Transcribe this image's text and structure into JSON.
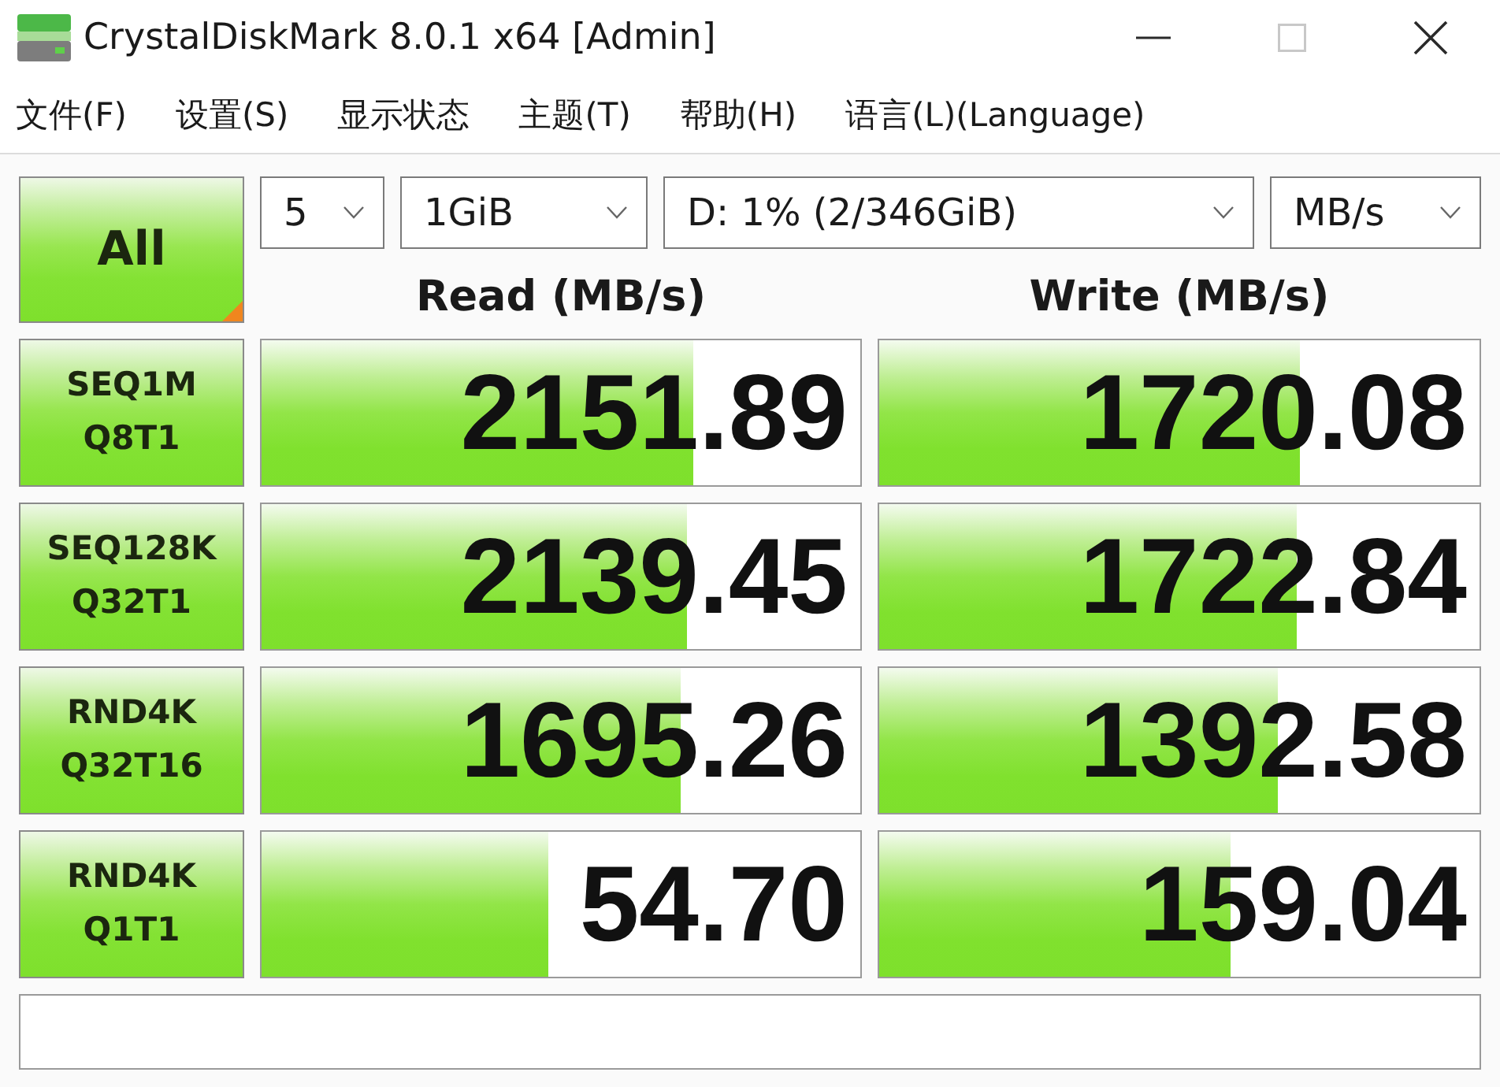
{
  "window": {
    "title": "CrystalDiskMark 8.0.1 x64 [Admin]",
    "controls": [
      {
        "kind": "minimize",
        "disabled": false
      },
      {
        "kind": "maximize",
        "disabled": true
      },
      {
        "kind": "close",
        "disabled": false
      }
    ]
  },
  "menu": [
    "文件(F)",
    "设置(S)",
    "显示状态",
    "主题(T)",
    "帮助(H)",
    "语言(L)(Language)"
  ],
  "all_button": {
    "label": "All"
  },
  "dropdowns": [
    {
      "kind": "count",
      "value": "5"
    },
    {
      "kind": "size",
      "value": "1GiB"
    },
    {
      "kind": "drive",
      "value": "D: 1% (2/346GiB)"
    },
    {
      "kind": "unit",
      "value": "MB/s"
    }
  ],
  "headers": {
    "read": "Read (MB/s)",
    "write": "Write (MB/s)"
  },
  "tests": [
    {
      "name": "SEQ1M",
      "params": "Q8T1",
      "read": {
        "value": "2151.89",
        "level": 0.72
      },
      "write": {
        "value": "1720.08",
        "level": 0.7
      }
    },
    {
      "name": "SEQ128K",
      "params": "Q32T1",
      "read": {
        "value": "2139.45",
        "level": 0.71
      },
      "write": {
        "value": "1722.84",
        "level": 0.695
      }
    },
    {
      "name": "RND4K",
      "params": "Q32T16",
      "read": {
        "value": "1695.26",
        "level": 0.7
      },
      "write": {
        "value": "1392.58",
        "level": 0.665
      }
    },
    {
      "name": "RND4K",
      "params": "Q1T1",
      "read": {
        "value": "54.70",
        "level": 0.48
      },
      "write": {
        "value": "159.04",
        "level": 0.585
      }
    }
  ]
}
